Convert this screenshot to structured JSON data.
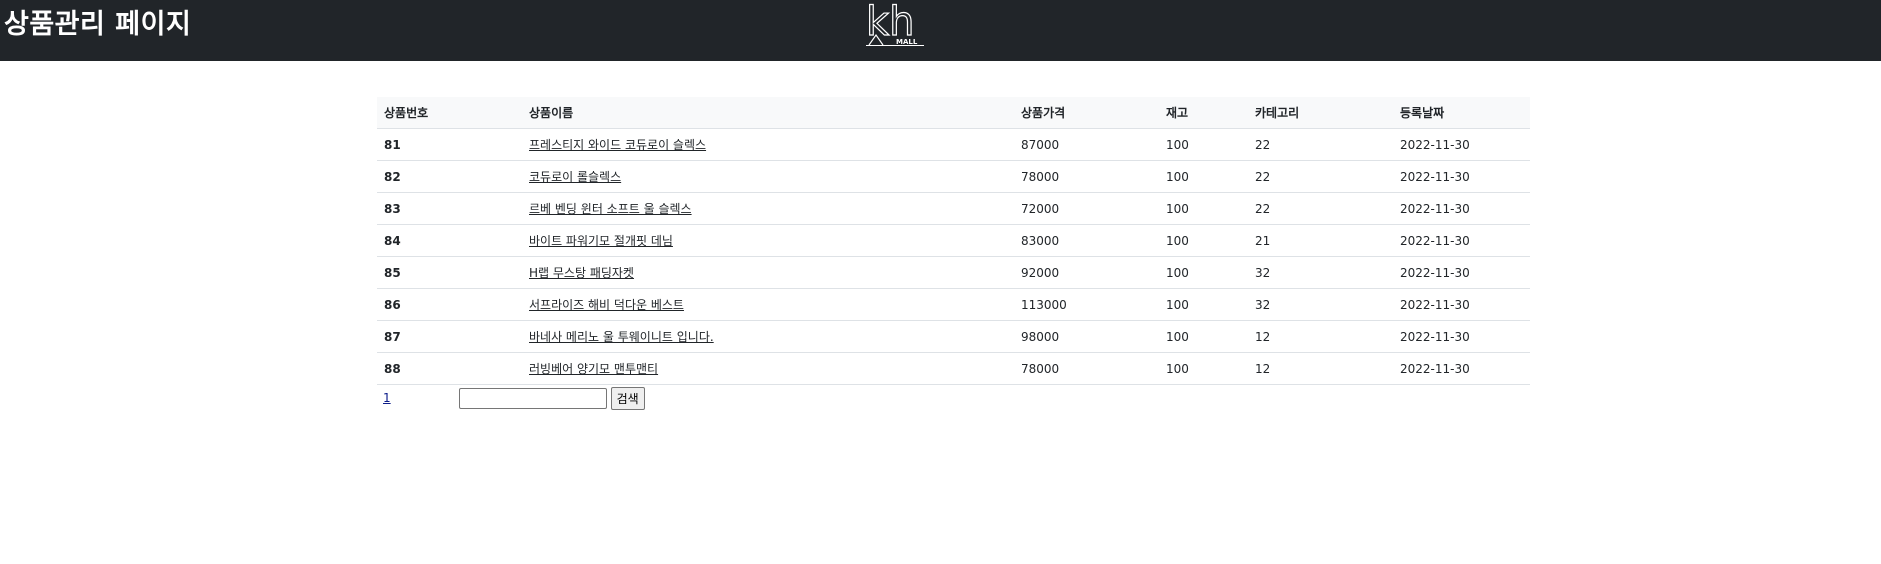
{
  "header": {
    "title": "상품관리 페이지",
    "logo_text": "kh",
    "logo_subtext": "MALL"
  },
  "table": {
    "headers": [
      "상품번호",
      "상품이름",
      "상품가격",
      "재고",
      "카테고리",
      "등록날짜"
    ],
    "rows": [
      {
        "no": "81",
        "name": "프레스티지 와이드 코듀로이 슬렉스",
        "price": "87000",
        "stock": "100",
        "category": "22",
        "date": "2022-11-30"
      },
      {
        "no": "82",
        "name": "코듀로이 롤슬렉스",
        "price": "78000",
        "stock": "100",
        "category": "22",
        "date": "2022-11-30"
      },
      {
        "no": "83",
        "name": "르베 벤딩 윈터 소프트 울 슬렉스",
        "price": "72000",
        "stock": "100",
        "category": "22",
        "date": "2022-11-30"
      },
      {
        "no": "84",
        "name": "바이트 파워기모 절개핏 데님",
        "price": "83000",
        "stock": "100",
        "category": "21",
        "date": "2022-11-30"
      },
      {
        "no": "85",
        "name": "H랩 무스탕 패딩자켓",
        "price": "92000",
        "stock": "100",
        "category": "32",
        "date": "2022-11-30"
      },
      {
        "no": "86",
        "name": "서프라이즈 해비 덕다운 베스트",
        "price": "113000",
        "stock": "100",
        "category": "32",
        "date": "2022-11-30"
      },
      {
        "no": "87",
        "name": "바네사 메리노 울 투웨이니트 입니다.",
        "price": "98000",
        "stock": "100",
        "category": "12",
        "date": "2022-11-30"
      },
      {
        "no": "88",
        "name": "러빙베어 양기모 맨투맨티",
        "price": "78000",
        "stock": "100",
        "category": "12",
        "date": "2022-11-30"
      }
    ]
  },
  "pagination": {
    "current_page": "1"
  },
  "search": {
    "value": "",
    "button_label": "검색"
  }
}
